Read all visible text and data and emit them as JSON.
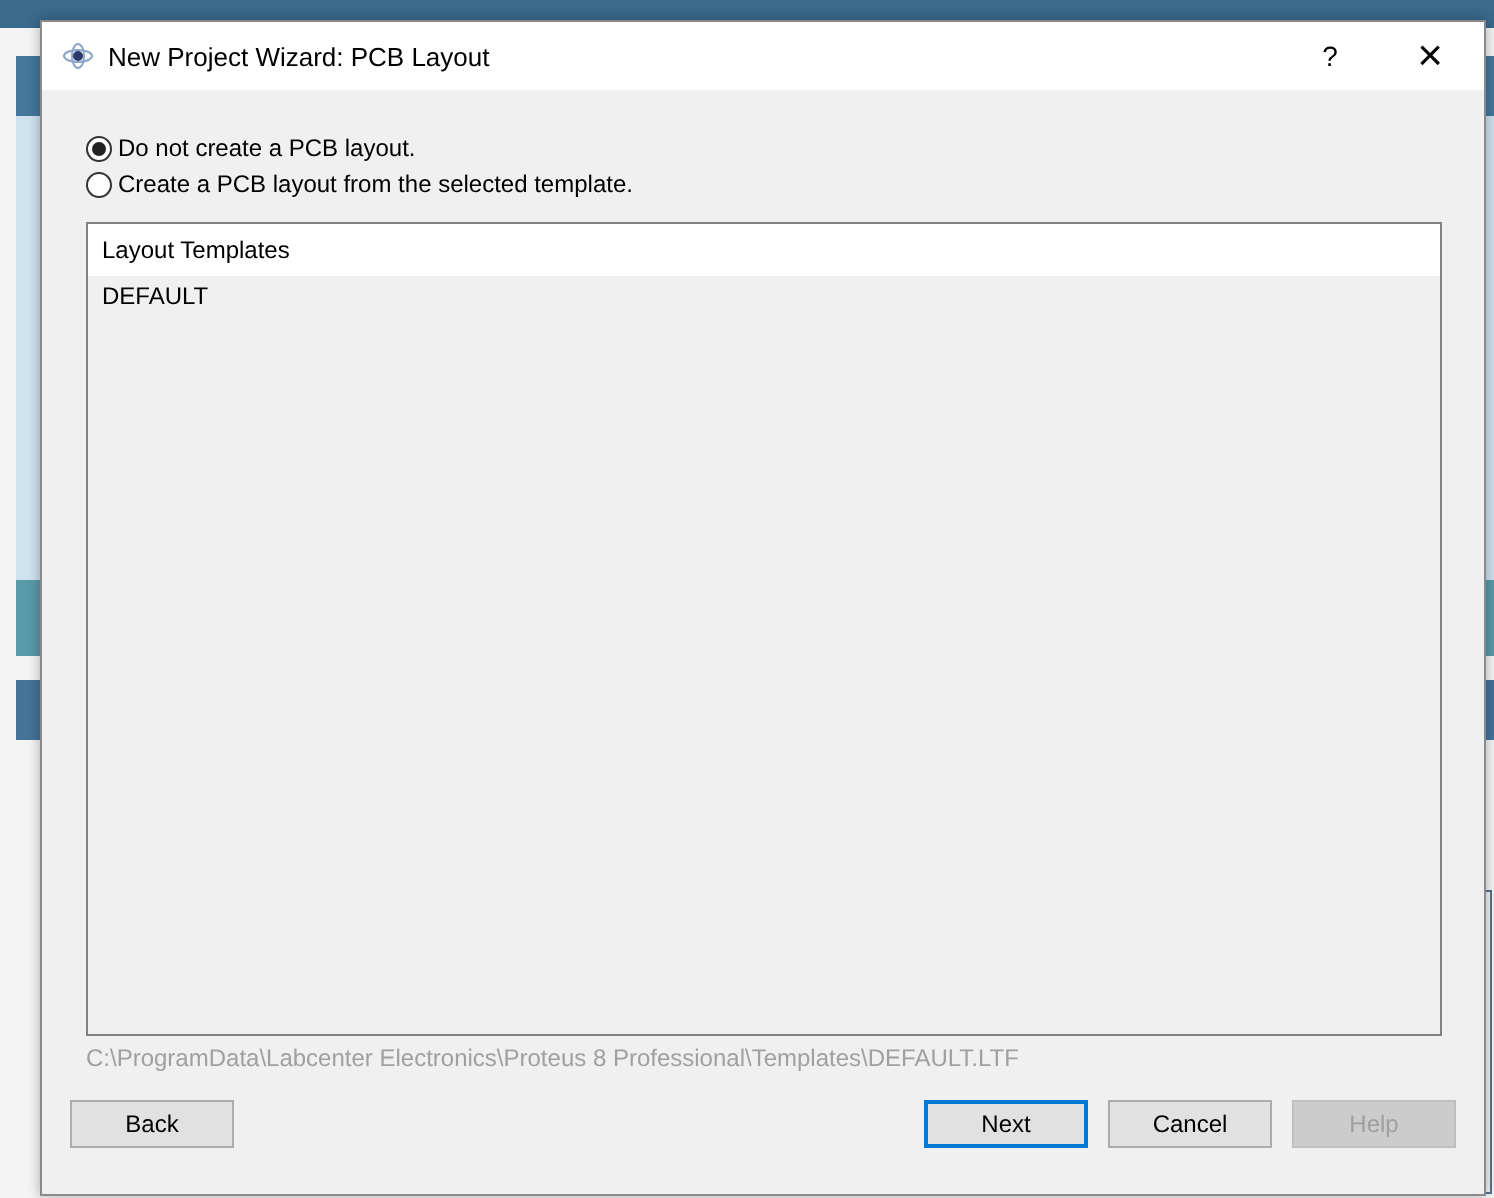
{
  "window": {
    "title": "New Project Wizard: PCB Layout",
    "help": "?",
    "close": "×"
  },
  "options": [
    {
      "label": "Do not create a PCB layout.",
      "selected": true
    },
    {
      "label": "Create a PCB layout from the selected template.",
      "selected": false
    }
  ],
  "templates": {
    "header": "Layout Templates",
    "rows": [
      {
        "label": "DEFAULT"
      }
    ]
  },
  "path": "C:\\ProgramData\\Labcenter Electronics\\Proteus 8 Professional\\Templates\\DEFAULT.LTF",
  "buttons": [
    {
      "label": "Back",
      "default": false,
      "disabled": false
    },
    {
      "label": "Next",
      "default": true,
      "disabled": false
    },
    {
      "label": "Cancel",
      "default": false,
      "disabled": false
    },
    {
      "label": "Help",
      "default": false,
      "disabled": true
    }
  ]
}
